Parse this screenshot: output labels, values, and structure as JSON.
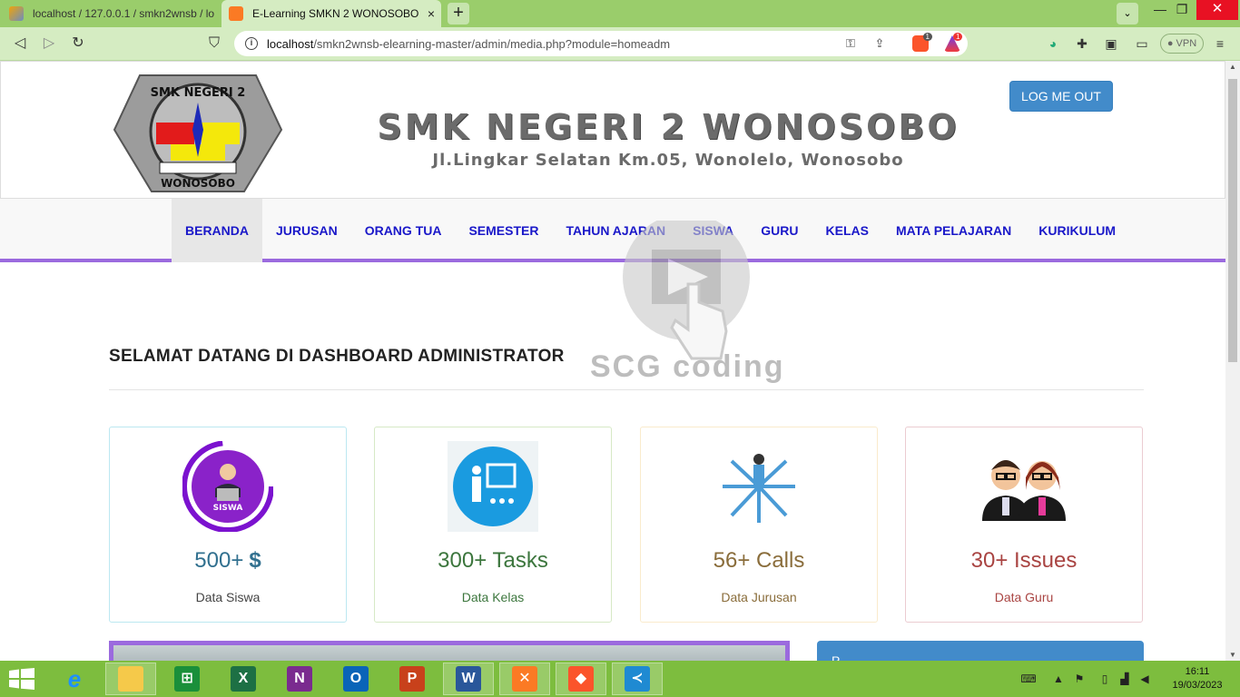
{
  "browser": {
    "tabs": [
      {
        "title": "localhost / 127.0.0.1 / smkn2wnsb / lo",
        "close": "×"
      },
      {
        "title": "E-Learning SMKN 2 WONOSOBO",
        "close": "×"
      }
    ],
    "new_tab": "+",
    "tab_dropdown": "⌄",
    "window": {
      "minimize": "—",
      "maximize": "❐",
      "close": "✕"
    },
    "nav": {
      "back": "◁",
      "forward": "▷",
      "reload": "↻",
      "bookmark": "⛉"
    },
    "url_host": "localhost",
    "url_path": "/smkn2wnsb-elearning-master/admin/media.php?module=homeadm",
    "brave_badge": "1",
    "rewards_badge": "1",
    "vpn_label": "● VPN",
    "menu": "≡"
  },
  "header": {
    "logo_top_text": "SMK NEGERI 2",
    "logo_bottom_text": "WONOSOBO",
    "school_name": "SMK NEGERI 2 WONOSOBO",
    "address": "Jl.Lingkar Selatan Km.05, Wonolelo, Wonosobo",
    "logout_label": "LOG ME OUT"
  },
  "menu": [
    "BERANDA",
    "JURUSAN",
    "ORANG TUA",
    "SEMESTER",
    "TAHUN AJARAN",
    "SISWA",
    "GURU",
    "KELAS",
    "MATA PELAJARAN",
    "KURIKULUM"
  ],
  "watermark": "SCG coding",
  "welcome_title": "SELAMAT DATANG DI DASHBOARD ADMINISTRATOR",
  "cards": [
    {
      "number": "500+",
      "suffix": "$",
      "label": "Data Siswa",
      "badge": "SISWA"
    },
    {
      "number": "300+ Tasks",
      "label": "Data Kelas"
    },
    {
      "number": "56+ Calls",
      "label": "Data Jurusan"
    },
    {
      "number": "30+ Issues",
      "label": "Data Guru"
    }
  ],
  "panel_title": "P",
  "taskbar": {
    "apps": [
      "Internet Explorer",
      "File Explorer",
      "Store",
      "Excel",
      "OneNote",
      "Outlook",
      "PowerPoint",
      "Word",
      "XAMPP",
      "Brave",
      "VS Code"
    ],
    "excel": "X",
    "onenote": "N",
    "outlook": "O",
    "powerpoint": "P",
    "word": "W",
    "time": "16:11",
    "date": "19/03/2023"
  },
  "colors": {
    "accent_purple": "#9b6ade",
    "menu_link": "#1a18c9",
    "button_blue": "#428bca",
    "taskbar_green": "#7dbd3e",
    "chrome_green": "#9acd6b"
  }
}
